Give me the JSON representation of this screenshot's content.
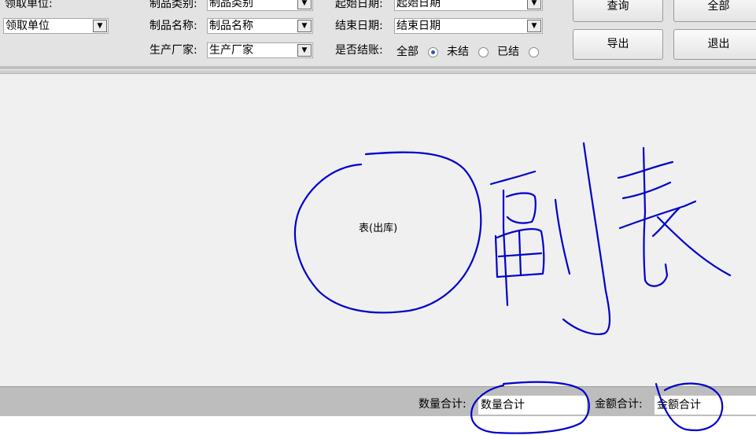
{
  "filters": {
    "dept_label": "领取单位:",
    "dept_value": "领取单位",
    "category_label": "制品类别:",
    "category_value": "制品类别",
    "name_label": "制品名称:",
    "name_value": "制品名称",
    "maker_label": "生产厂家:",
    "maker_value": "生产厂家",
    "start_label": "起始日期:",
    "start_value": "起始日期",
    "end_label": "结束日期:",
    "end_value": "结束日期",
    "settled_label": "是否结账:",
    "radio_all": "全部",
    "radio_unsettled": "未结",
    "radio_settled": "已结",
    "selected_radio": "全部"
  },
  "buttons": {
    "query": "查询",
    "all": "全部",
    "export": "导出",
    "exit": "退出"
  },
  "content": {
    "center_text": "表(出库)",
    "annotation_color": "#0000cc"
  },
  "footer": {
    "qty_label": "数量合计:",
    "qty_value": "数量合计",
    "amount_label": "金额合计:",
    "amount_value": "金额合计"
  }
}
